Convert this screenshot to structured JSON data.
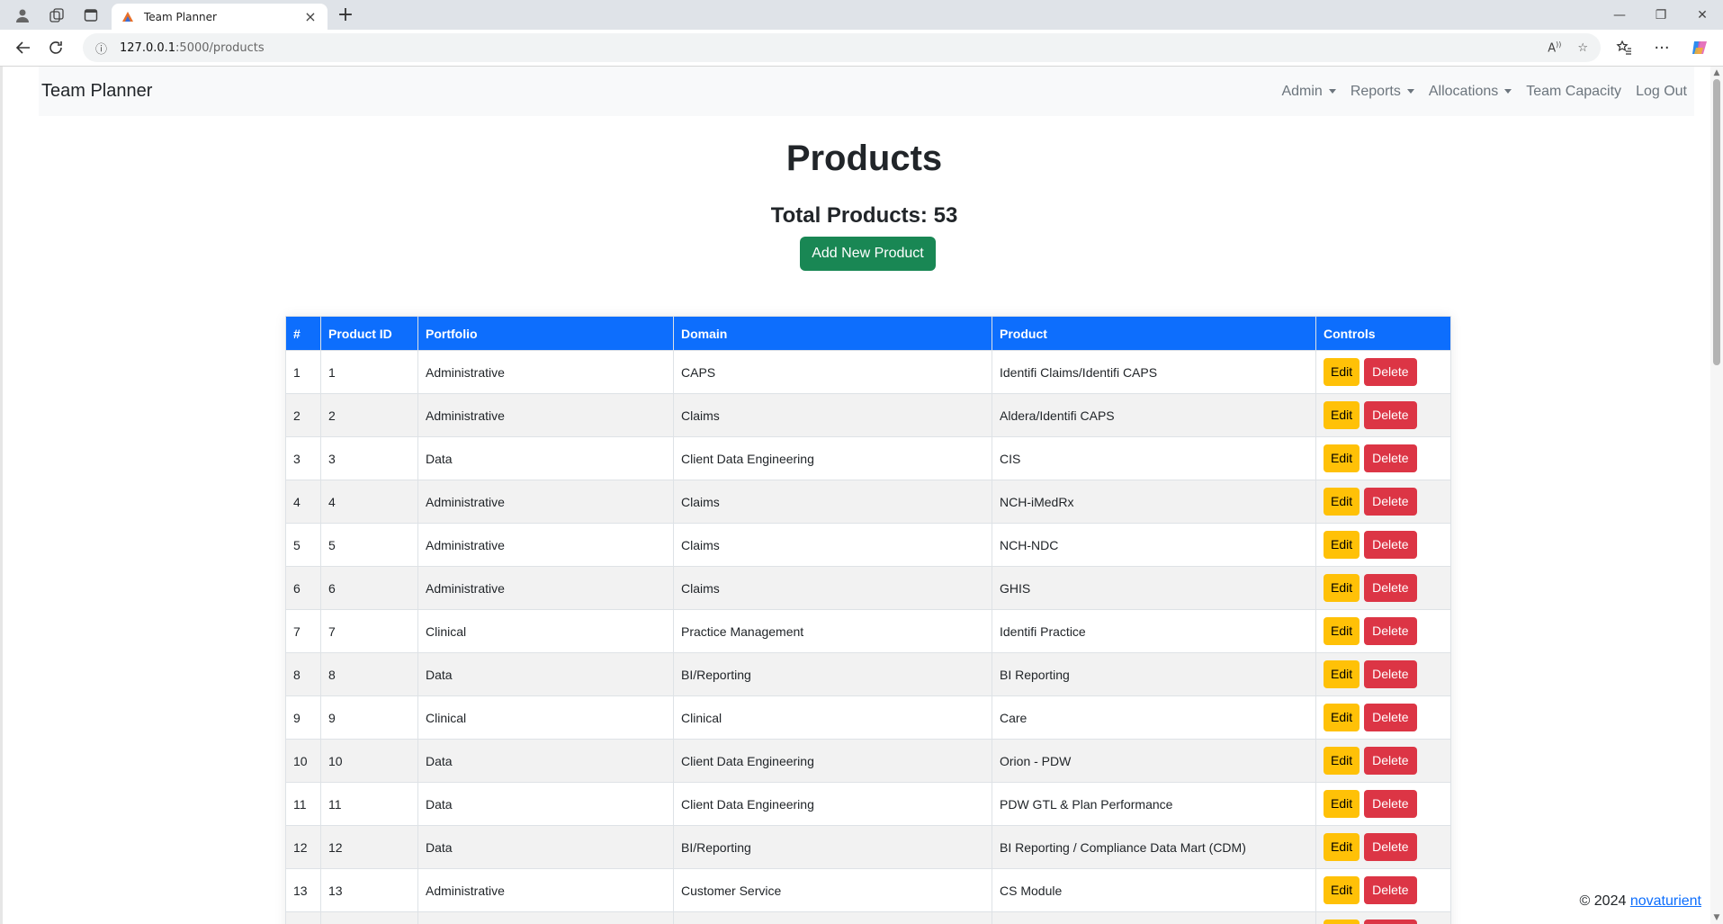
{
  "browser": {
    "tab_title": "Team Planner",
    "url_host": "127.0.0.1",
    "url_path": ":5000/products"
  },
  "nav": {
    "brand": "Team Planner",
    "links": [
      {
        "label": "Admin",
        "dropdown": true
      },
      {
        "label": "Reports",
        "dropdown": true
      },
      {
        "label": "Allocations",
        "dropdown": true
      },
      {
        "label": "Team Capacity",
        "dropdown": false
      },
      {
        "label": "Log Out",
        "dropdown": false
      }
    ]
  },
  "page": {
    "title": "Products",
    "total": "Total Products: 53",
    "add_button": "Add New Product"
  },
  "table": {
    "headers": [
      "#",
      "Product ID",
      "Portfolio",
      "Domain",
      "Product",
      "Controls"
    ],
    "edit_label": "Edit",
    "delete_label": "Delete",
    "rows": [
      [
        "1",
        "1",
        "Administrative",
        "CAPS",
        "Identifi Claims/Identifi CAPS"
      ],
      [
        "2",
        "2",
        "Administrative",
        "Claims",
        "Aldera/Identifi CAPS"
      ],
      [
        "3",
        "3",
        "Data",
        "Client Data Engineering",
        "CIS"
      ],
      [
        "4",
        "4",
        "Administrative",
        "Claims",
        "NCH-iMedRx"
      ],
      [
        "5",
        "5",
        "Administrative",
        "Claims",
        "NCH-NDC"
      ],
      [
        "6",
        "6",
        "Administrative",
        "Claims",
        "GHIS"
      ],
      [
        "7",
        "7",
        "Clinical",
        "Practice Management",
        "Identifi Practice"
      ],
      [
        "8",
        "8",
        "Data",
        "BI/Reporting",
        "BI Reporting"
      ],
      [
        "9",
        "9",
        "Clinical",
        "Clinical",
        "Care"
      ],
      [
        "10",
        "10",
        "Data",
        "Client Data Engineering",
        "Orion - PDW"
      ],
      [
        "11",
        "11",
        "Data",
        "Client Data Engineering",
        "PDW GTL & Plan Performance"
      ],
      [
        "12",
        "12",
        "Data",
        "BI/Reporting",
        "BI Reporting / Compliance Data Mart (CDM)"
      ],
      [
        "13",
        "13",
        "Administrative",
        "Customer Service",
        "CS Module"
      ],
      [
        "",
        "",
        "",
        "",
        ""
      ]
    ]
  },
  "footer": {
    "copyright": "© 2024",
    "link": "novaturient"
  }
}
